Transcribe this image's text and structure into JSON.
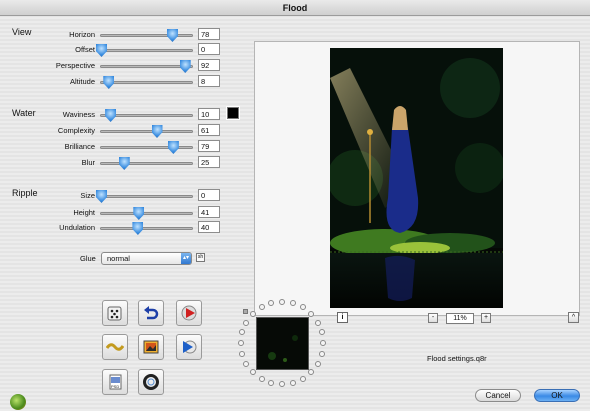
{
  "window": {
    "title": "Flood"
  },
  "view": {
    "heading": "View",
    "sliders": [
      {
        "label": "Horizon",
        "value": "78",
        "level": 0.78
      },
      {
        "label": "Offset",
        "value": "0",
        "level": 0.0
      },
      {
        "label": "Perspective",
        "value": "92",
        "level": 0.92
      },
      {
        "label": "Altitude",
        "value": "8",
        "level": 0.08
      }
    ]
  },
  "water": {
    "heading": "Water",
    "color": "#000000",
    "sliders": [
      {
        "label": "Waviness",
        "value": "10",
        "level": 0.1
      },
      {
        "label": "Complexity",
        "value": "61",
        "level": 0.61
      },
      {
        "label": "Brilliance",
        "value": "79",
        "level": 0.79
      },
      {
        "label": "Blur",
        "value": "25",
        "level": 0.25
      }
    ]
  },
  "ripple": {
    "heading": "Ripple",
    "sliders": [
      {
        "label": "Size",
        "value": "0",
        "level": 0.0
      },
      {
        "label": "Height",
        "value": "41",
        "level": 0.41
      },
      {
        "label": "Undulation",
        "value": "40",
        "level": 0.4
      }
    ]
  },
  "glue": {
    "label": "Glue",
    "selected": "normal",
    "button": "sh"
  },
  "zoom": {
    "minus": "-",
    "value": "11%",
    "plus": "+"
  },
  "info_label": "i",
  "caret_label": "^",
  "settings_file": "Flood settings.q8r",
  "buttons": {
    "cancel": "Cancel",
    "ok": "OK"
  },
  "tool_icons": [
    "dice-icon",
    "undo-icon",
    "play-red-icon",
    "wave-icon",
    "photo-icon",
    "play-blue-icon",
    "psd-file-icon",
    "ring-icon"
  ]
}
